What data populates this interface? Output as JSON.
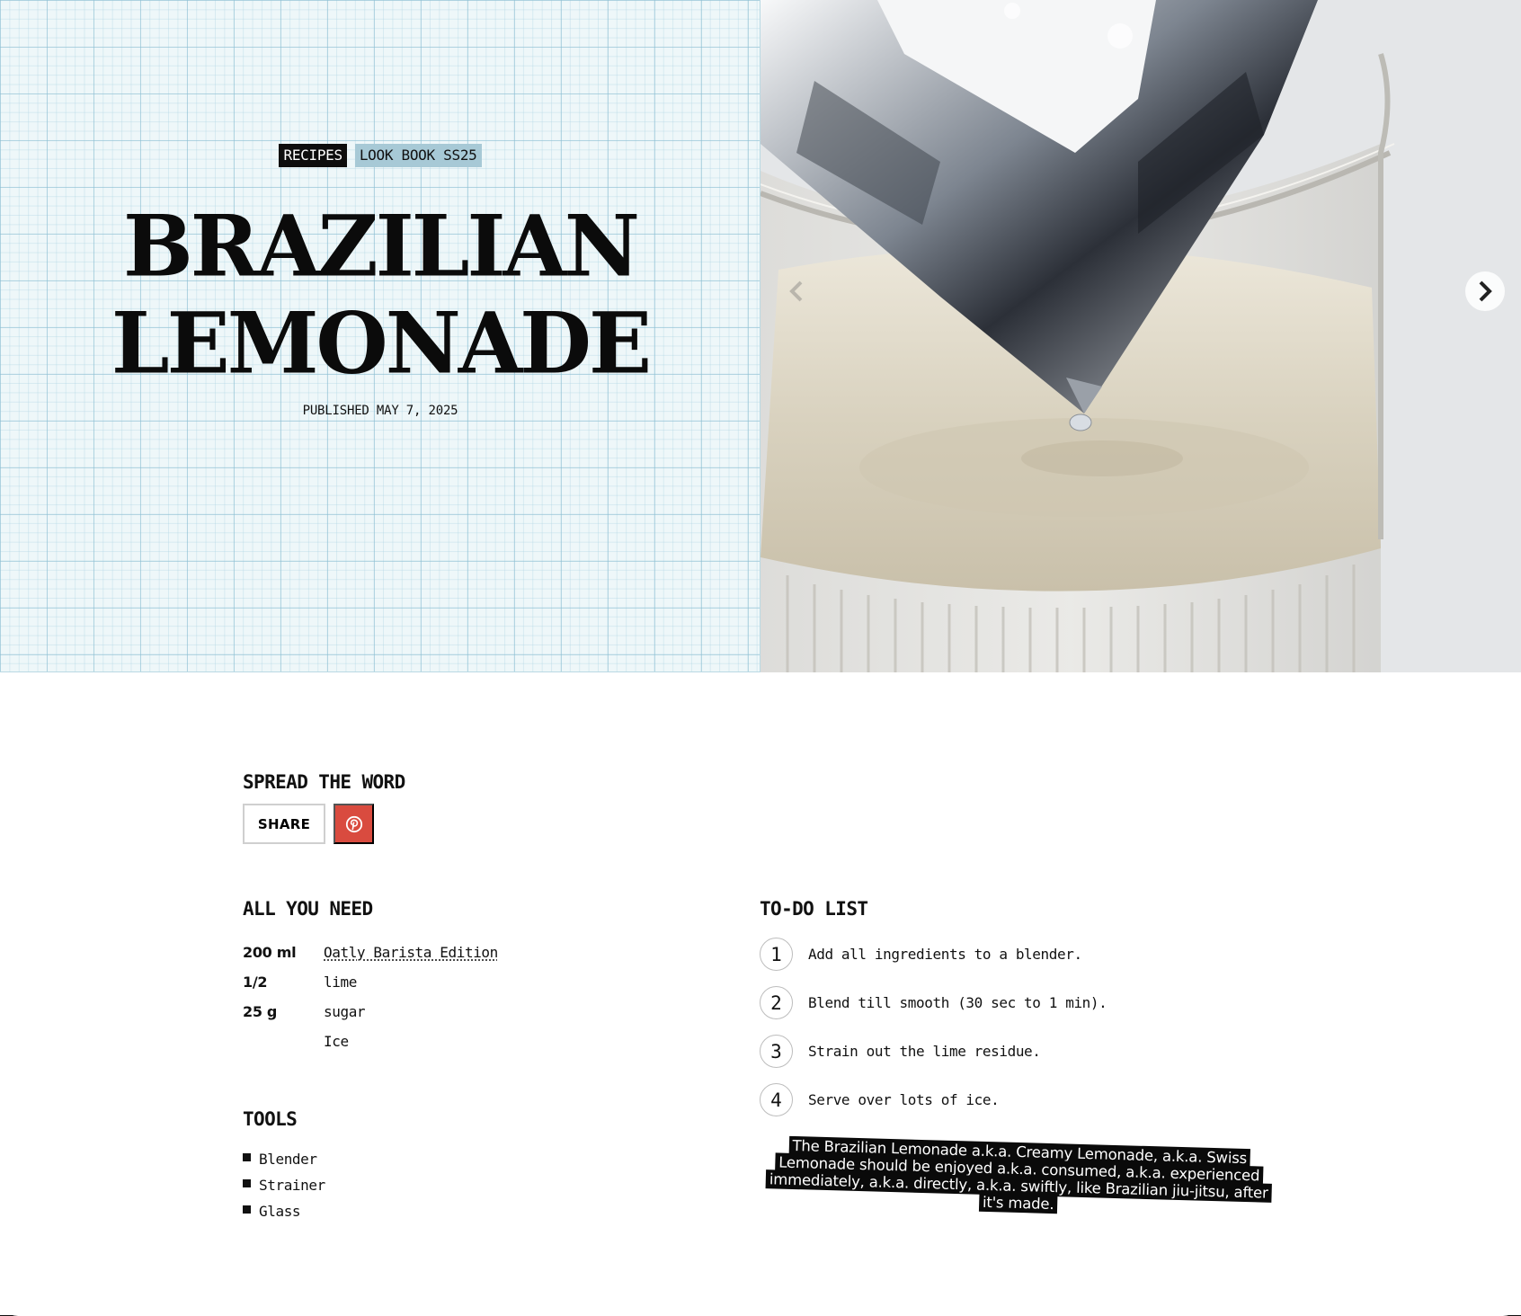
{
  "hero": {
    "tags": [
      "RECIPES",
      "LOOK BOOK SS25"
    ],
    "title_line1": "BRAZILIAN",
    "title_line2": "LEMONADE",
    "published": "PUBLISHED MAY 7, 2025",
    "image_alt": "Glass of creamy lemonade with a large clear ice cube",
    "prev_icon": "chevron-left-icon",
    "next_icon": "chevron-right-icon"
  },
  "share": {
    "heading": "SPREAD THE WORD",
    "share_label": "SHARE",
    "pinterest_icon": "pinterest-icon",
    "pinterest_color": "#d94b3f"
  },
  "ingredients": {
    "heading": "ALL YOU NEED",
    "items": [
      {
        "qty": "200 ml",
        "name": "Oatly Barista Edition",
        "link": true
      },
      {
        "qty": "1/2",
        "name": "lime",
        "link": false
      },
      {
        "qty": "25 g",
        "name": "sugar",
        "link": false
      },
      {
        "qty": "",
        "name": "Ice",
        "link": false
      }
    ]
  },
  "tools": {
    "heading": "TOOLS",
    "items": [
      "Blender",
      "Strainer",
      "Glass"
    ]
  },
  "todo": {
    "heading": "TO-DO LIST",
    "steps": [
      {
        "num": "1",
        "text": "Add all ingredients to a blender."
      },
      {
        "num": "2",
        "text": "Blend till smooth (30 sec to 1 min)."
      },
      {
        "num": "3",
        "text": "Strain out the lime residue."
      },
      {
        "num": "4",
        "text": "Serve over lots of ice."
      }
    ],
    "note": "The Brazilian Lemonade a.k.a. Creamy Lemonade, a.k.a. Swiss Lemonade should be enjoyed a.k.a. consumed, a.k.a. experienced immediately, a.k.a. directly, a.k.a. swiftly, like Brazilian jiu-jitsu, after it's made."
  },
  "colors": {
    "grid_bg": "#eef7f9",
    "tag_dark": "#0d0d0d",
    "tag_light": "#a7c9d6",
    "note_bg": "#0a0a0a"
  }
}
